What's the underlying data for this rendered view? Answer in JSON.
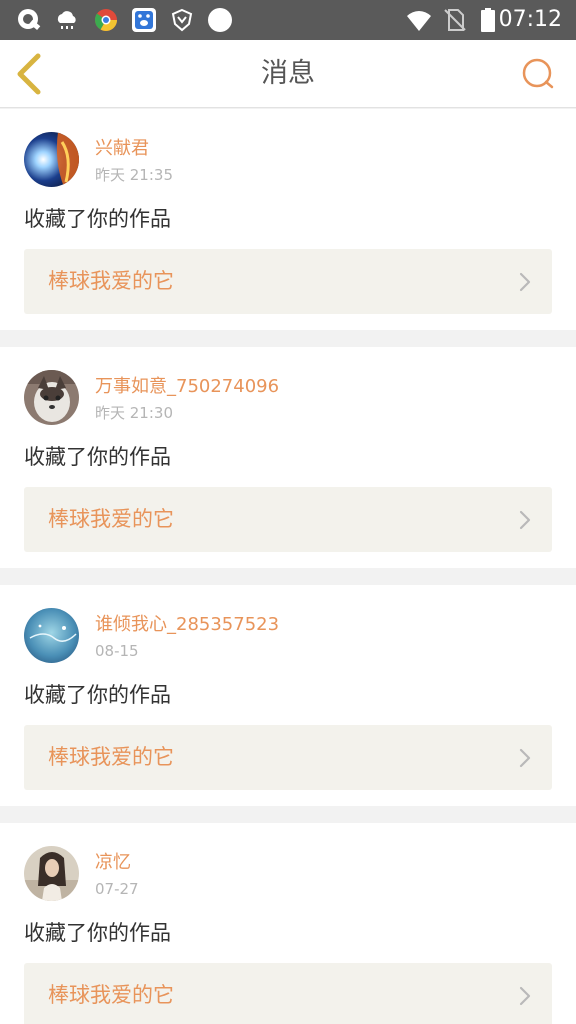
{
  "status_bar": {
    "time": "07:12",
    "icons": [
      "q-app-icon",
      "weather-icon",
      "chrome-icon",
      "baidu-icon",
      "shield-icon",
      "circle-icon",
      "wifi-icon",
      "no-sim-icon",
      "battery-icon"
    ]
  },
  "header": {
    "title": "消息",
    "back_icon": "chevron-left-icon",
    "search_icon": "search-icon",
    "accent_color": "#e8945a",
    "back_color": "#d8b440"
  },
  "messages": [
    {
      "username": "兴献君",
      "time": "昨天 21:35",
      "action": "收藏了你的作品",
      "work_title": "棒球我爱的它",
      "avatar": "avatar-fire-icon"
    },
    {
      "username": "万事如意_750274096",
      "time": "昨天 21:30",
      "action": "收藏了你的作品",
      "work_title": "棒球我爱的它",
      "avatar": "avatar-dog-icon"
    },
    {
      "username": "谁倾我心_285357523",
      "time": "08-15",
      "action": "收藏了你的作品",
      "work_title": "棒球我爱的它",
      "avatar": "avatar-blue-icon"
    },
    {
      "username": "凉忆",
      "time": "07-27",
      "action": "收藏了你的作品",
      "work_title": "棒球我爱的它",
      "avatar": "avatar-girl-icon"
    }
  ]
}
